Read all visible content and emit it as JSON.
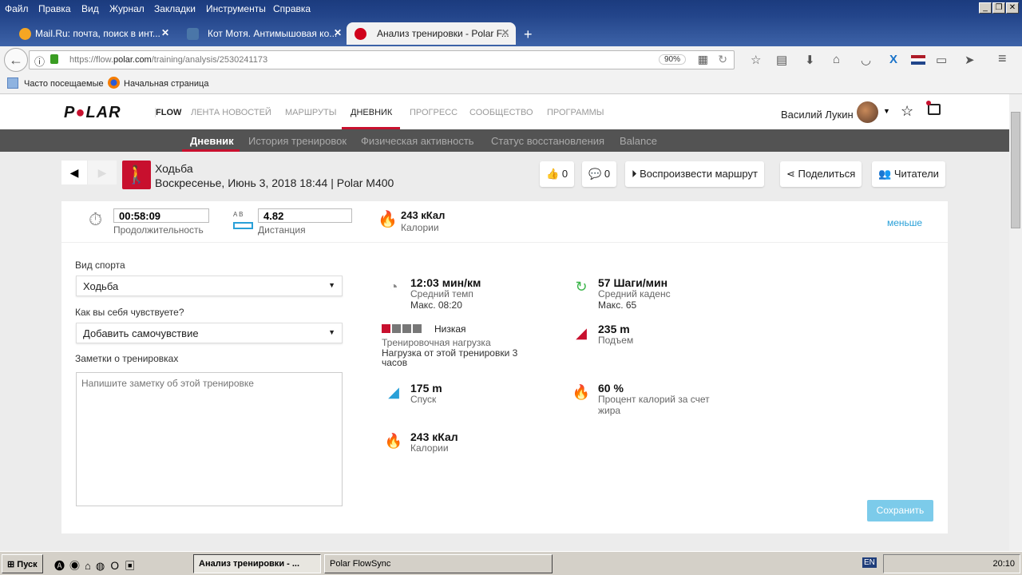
{
  "browser": {
    "menu": [
      "Файл",
      "Правка",
      "Вид",
      "Журнал",
      "Закладки",
      "Инструменты",
      "Справка"
    ],
    "tabs": [
      {
        "title": "Mail.Ru: почта, поиск в инт...",
        "color": "#f5a623"
      },
      {
        "title": "Кот Мотя. Антимышовая ко...",
        "color": "#4a76a8"
      },
      {
        "title": "Анализ тренировки - Polar F...",
        "color": "#d0021b"
      }
    ],
    "url_prefix": "https://flow.",
    "url_domain": "polar.com",
    "url_path": "/training/analysis/2530241173",
    "zoom": "90%",
    "bookmarks": [
      "Часто посещаемые",
      "Начальная страница"
    ]
  },
  "polar": {
    "logo": "POLAR",
    "flow": "FLOW",
    "nav": [
      "ЛЕНТА НОВОСТЕЙ",
      "МАРШРУТЫ",
      "ДНЕВНИК",
      "ПРОГРЕСС",
      "СООБЩЕСТВО",
      "ПРОГРАММЫ"
    ],
    "user": "Василий Лукин",
    "subnav": [
      "Дневник",
      "История тренировок",
      "Физическая активность",
      "Статус восстановления",
      "Balance"
    ],
    "sport_title": "Ходьба",
    "subtitle": "Воскресенье, Июнь 3, 2018 18:44 | Polar M400",
    "likes": "0",
    "comments": "0",
    "actions": [
      "Воспроизвести маршрут",
      "Поделиться",
      "Читатели"
    ],
    "summary": {
      "duration": "00:58:09",
      "duration_label": "Продолжительность",
      "ab": "A  B",
      "distance": "4.82",
      "distance_label": "Дистанция",
      "calories": "243 кКал",
      "calories_label": "Калории",
      "less": "меньше"
    },
    "form": {
      "sport_label": "Вид спорта",
      "sport_value": "Ходьба",
      "feel_label": "Как вы себя чувствуете?",
      "feel_value": "Добавить самочувствие",
      "notes_label": "Заметки о тренировках",
      "notes_placeholder": "Напишите заметку об этой тренировке",
      "save": "Сохранить"
    },
    "metrics": {
      "pace": {
        "value": "12:03 мин/км",
        "label": "Средний темп",
        "extra": "Макс. 08:20"
      },
      "cadence": {
        "value": "57 Шаги/мин",
        "label": "Средний каденс",
        "extra": "Макс. 65"
      },
      "load": {
        "value": "Низкая",
        "label": "Тренировочная нагрузка",
        "extra": "Нагрузка от этой тренировки 3 часов",
        "level": 1,
        "max": 5
      },
      "ascent": {
        "value": "235 m",
        "label": "Подъем"
      },
      "descent": {
        "value": "175 m",
        "label": "Спуск"
      },
      "fat": {
        "value": "60 %",
        "label": "Процент калорий за счет жира"
      },
      "calories": {
        "value": "243 кКал",
        "label": "Калории"
      }
    }
  },
  "taskbar": {
    "start": "Пуск",
    "items": [
      "Анализ тренировки - ...",
      "Polar FlowSync"
    ],
    "lang": "EN",
    "clock": "20:10"
  }
}
